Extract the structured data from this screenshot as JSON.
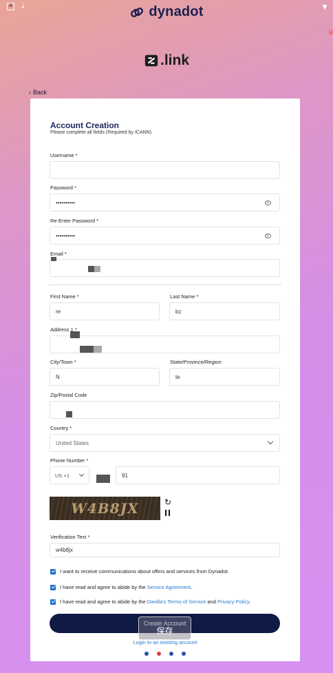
{
  "brand": {
    "name": "dynadot"
  },
  "tld": {
    "text": ".link"
  },
  "back": {
    "label": "Back"
  },
  "form": {
    "title": "Account Creation",
    "subtitle": "Please complete all fields (Required by ICANN)",
    "fields": {
      "username": {
        "label": "Username *",
        "value": ""
      },
      "password": {
        "label": "Password *",
        "value": "••••••••••"
      },
      "reenter_password": {
        "label": "Re-Enter Password *",
        "value": "••••••••••"
      },
      "email": {
        "label": "Email *",
        "value": ""
      },
      "first_name": {
        "label": "First Name *",
        "value": "re"
      },
      "last_name": {
        "label": "Last Name *",
        "value": "bz"
      },
      "address": {
        "label": "Address 1 *",
        "value": ""
      },
      "city": {
        "label": "City/Town *",
        "value": "N"
      },
      "state": {
        "label": "State/Province/Region",
        "value": "te"
      },
      "zip": {
        "label": "Zip/Postal Code",
        "value": ""
      },
      "country": {
        "label": "Country *",
        "value": "United States"
      },
      "phone": {
        "label": "Phone Number *",
        "code": "US +1",
        "value": "91"
      },
      "verification": {
        "label": "Verification Text *",
        "value": "w4b8jx"
      }
    },
    "captcha_text": "W4B8JX",
    "checkboxes": [
      {
        "text": "I want to receive communications about offers and services from Dynadot.",
        "checked": true
      },
      {
        "text_pre": "I have read and agree to abide by the ",
        "link": "Service Agreement",
        "text_post": ".",
        "checked": true
      },
      {
        "text_pre": "I have read and agree to abide by the ",
        "link": "Dwolla's Terms of Service",
        "text_mid": " and ",
        "link2": "Privacy Policy",
        "text_post": ".",
        "checked": true
      }
    ],
    "create_button": "Create Account",
    "save_overlay": "保存",
    "login_link": "Login to an existing account"
  },
  "pagination": {
    "count": 4,
    "active": 2
  },
  "colors": {
    "accent": "#0f1a45",
    "link": "#1f7bd1",
    "checkbox": "#1f6fd1"
  }
}
